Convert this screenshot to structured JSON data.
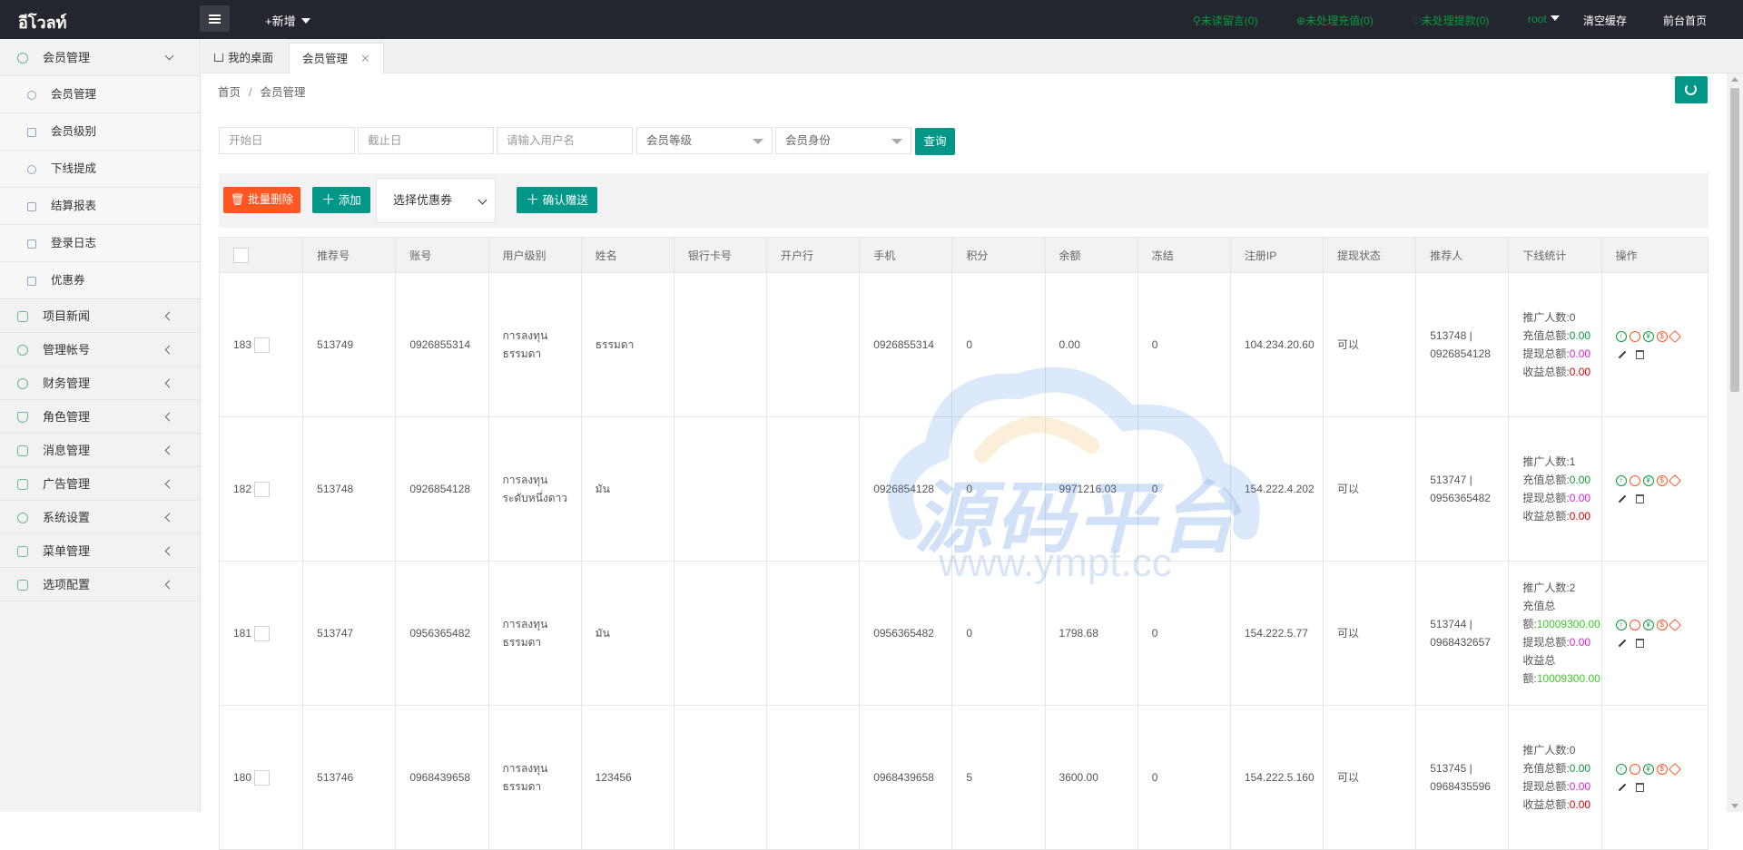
{
  "header": {
    "brand": "อีโวลท์",
    "new_label": "+新增",
    "unread_messages": "未读留言(0)",
    "unprocessed_recharge": "未处理充值(0)",
    "unprocessed_withdraw": "未处理提款(0)",
    "user": "root",
    "clear_cache": "清空缓存",
    "frontend_home": "前台首页"
  },
  "sidebar": {
    "groups": [
      {
        "label": "会员管理",
        "icon": "user-icon",
        "expanded": true,
        "items": [
          {
            "label": "会员管理",
            "icon": "user-icon"
          },
          {
            "label": "会员级别",
            "icon": "level-icon"
          },
          {
            "label": "下线提成",
            "icon": "gauge-icon"
          },
          {
            "label": "结算报表",
            "icon": "report-icon"
          },
          {
            "label": "登录日志",
            "icon": "calendar-icon"
          },
          {
            "label": "优惠券",
            "icon": "coupon-icon"
          }
        ]
      },
      {
        "label": "项目新闻",
        "icon": "book-icon"
      },
      {
        "label": "管理帐号",
        "icon": "user-icon"
      },
      {
        "label": "财务管理",
        "icon": "yen-icon"
      },
      {
        "label": "角色管理",
        "icon": "shield-icon"
      },
      {
        "label": "消息管理",
        "icon": "speaker-icon"
      },
      {
        "label": "广告管理",
        "icon": "image-icon"
      },
      {
        "label": "系统设置",
        "icon": "gear-icon"
      },
      {
        "label": "菜单管理",
        "icon": "grid-icon"
      },
      {
        "label": "选项配置",
        "icon": "wrench-icon"
      }
    ]
  },
  "tabs": [
    {
      "label": "我的桌面",
      "icon": "home-icon"
    },
    {
      "label": "会员管理",
      "closable": true,
      "active": true
    }
  ],
  "breadcrumb": [
    "首页",
    "会员管理"
  ],
  "filters": {
    "start_date": "开始日",
    "end_date": "截止日",
    "username": "请输入用户名",
    "member_level": "会员等级",
    "member_identity": "会员身份",
    "query": "查询"
  },
  "toolbar": {
    "batch_delete": "批量删除",
    "add": "添加",
    "coupon_select": "选择优惠券",
    "confirm_gift": "确认赠送"
  },
  "table": {
    "columns": [
      "",
      "推荐号",
      "账号",
      "用户级别",
      "姓名",
      "银行卡号",
      "开户行",
      "手机",
      "积分",
      "余额",
      "冻结",
      "注册IP",
      "提现状态",
      "推荐人",
      "下线统计",
      "操作"
    ],
    "rows": [
      {
        "id": "183",
        "ref": "513749",
        "account": "0926855314",
        "level": "การลงทุนธรรมดา",
        "name": "ธรรมดา",
        "bank_card": "",
        "bank": "",
        "phone": "0926855314",
        "points": "0",
        "balance": "0.00",
        "frozen": "0",
        "ip": "104.234.20.60",
        "withdraw": "可以",
        "referrer": "513748 | 0926854128",
        "stats": {
          "promoters": "推广人数:0",
          "recharge_label": "充值总额:",
          "recharge": "0.00",
          "withdraw_label": "提现总额:",
          "withdraw": "0.00",
          "income_label": "收益总额:",
          "income": "0.00"
        }
      },
      {
        "id": "182",
        "ref": "513748",
        "account": "0926854128",
        "level": "การลงทุนระดับหนึ่งดาว",
        "name": "มัน",
        "bank_card": "",
        "bank": "",
        "phone": "0926854128",
        "points": "0",
        "balance": "9971216.03",
        "frozen": "0",
        "ip": "154.222.4.202",
        "withdraw": "可以",
        "referrer": "513747 | 0956365482",
        "stats": {
          "promoters": "推广人数:1",
          "recharge_label": "充值总额:",
          "recharge": "0.00",
          "withdraw_label": "提现总额:",
          "withdraw": "0.00",
          "income_label": "收益总额:",
          "income": "0.00"
        }
      },
      {
        "id": "181",
        "ref": "513747",
        "account": "0956365482",
        "level": "การลงทุนธรรมดา",
        "name": "มัน",
        "bank_card": "",
        "bank": "",
        "phone": "0956365482",
        "points": "0",
        "balance": "1798.68",
        "frozen": "0",
        "ip": "154.222.5.77",
        "withdraw": "可以",
        "referrer": "513744 | 0968432657",
        "stats": {
          "promoters": "推广人数:2",
          "recharge_label": "充值总额:",
          "recharge": "10009300.00",
          "withdraw_label": "提现总额:",
          "withdraw": "0.00",
          "income_label": "收益总额:",
          "income": "10009300.00"
        }
      },
      {
        "id": "180",
        "ref": "513746",
        "account": "0968439658",
        "level": "การลงทุนธรรมดา",
        "name": "123456",
        "bank_card": "",
        "bank": "",
        "phone": "0968439658",
        "points": "5",
        "balance": "3600.00",
        "frozen": "0",
        "ip": "154.222.5.160",
        "withdraw": "可以",
        "referrer": "513745 | 0968435596",
        "stats": {
          "promoters": "推广人数:0",
          "recharge_label": "充值总额:",
          "recharge": "0.00",
          "withdraw_label": "提现总额:",
          "withdraw": "0.00",
          "income_label": "收益总额:",
          "income": "0.00"
        }
      }
    ]
  },
  "watermark": {
    "text": "源码平台",
    "url": "www.ympt.cc"
  },
  "colors": {
    "primary": "#009688",
    "danger": "#ff5722",
    "topbar": "#23262e",
    "green": "#0b9b3c",
    "magenta": "#e020e0",
    "red": "#e00000"
  }
}
